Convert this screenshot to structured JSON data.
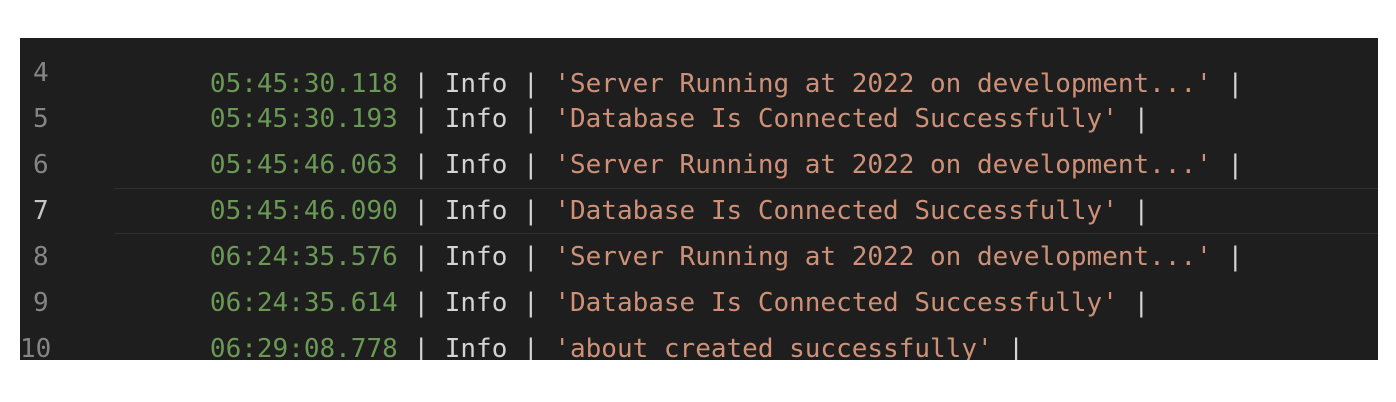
{
  "colors": {
    "background": "#1e1e1e",
    "timestamp": "#6a9955",
    "string": "#ce9178",
    "text": "#d4d4d4",
    "line_number": "#858585",
    "line_number_active": "#c6c6c6"
  },
  "editor": {
    "partial_top_line": {
      "timestamp": "05:45:30.118",
      "level": "Info",
      "message": "'Server Running at 2022 on development...'",
      "trailing": "|"
    },
    "lines": [
      {
        "number": "4",
        "timestamp": "05:45:30.193",
        "sep1": "|",
        "level": "Info",
        "sep2": "|",
        "message": "'Database Is Connected Successfully'",
        "trailing": "|"
      },
      {
        "number": "5",
        "timestamp": "05:45:46.063",
        "sep1": "|",
        "level": "Info",
        "sep2": "|",
        "message": "'Server Running at 2022 on development...'",
        "trailing": "|"
      },
      {
        "number": "6",
        "timestamp": "05:45:46.090",
        "sep1": "|",
        "level": "Info",
        "sep2": "|",
        "message": "'Database Is Connected Successfully'",
        "trailing": "|"
      },
      {
        "number": "7",
        "timestamp": "06:24:35.576",
        "sep1": "|",
        "level": "Info",
        "sep2": "|",
        "message": "'Server Running at 2022 on development...'",
        "trailing": "|"
      },
      {
        "number": "8",
        "timestamp": "06:24:35.614",
        "sep1": "|",
        "level": "Info",
        "sep2": "|",
        "message": "'Database Is Connected Successfully'",
        "trailing": "|"
      },
      {
        "number": "9",
        "timestamp": "06:29:08.778",
        "sep1": "|",
        "level": "Info",
        "sep2": "|",
        "message": "'about created successfully'",
        "trailing": "|"
      },
      {
        "number": "10"
      }
    ],
    "active_line": "7"
  }
}
